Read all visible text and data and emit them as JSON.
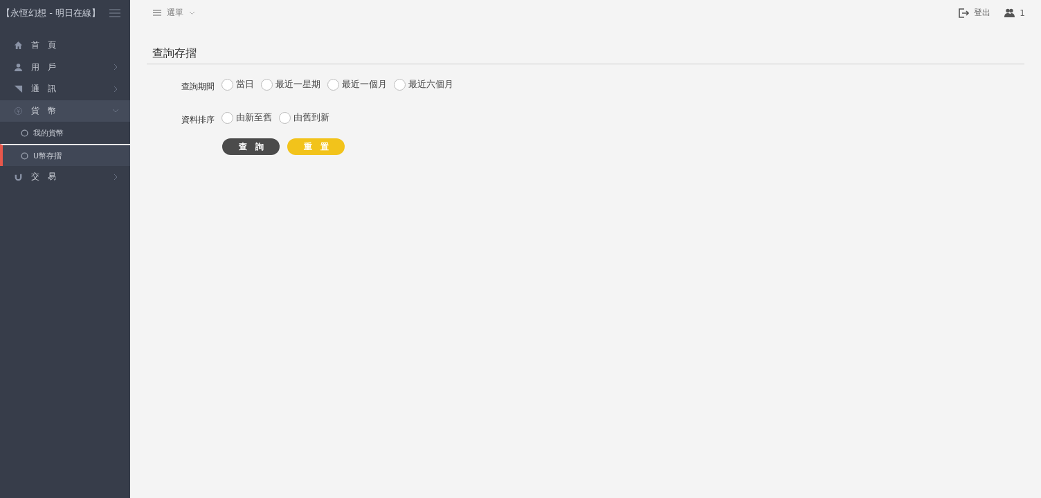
{
  "sidebar": {
    "title": "【永恆幻想 - 明日在線】",
    "items": [
      {
        "kind": "link",
        "label": "首　頁",
        "expanded": false,
        "selected": false
      },
      {
        "kind": "group",
        "label": "用　戶",
        "expanded": false,
        "selected": false
      },
      {
        "kind": "group",
        "label": "通　訊",
        "expanded": false,
        "selected": false
      },
      {
        "kind": "group",
        "label": "貨　幣",
        "expanded": true,
        "selected": false,
        "children": [
          {
            "label": "我的貨幣",
            "selected": false
          },
          {
            "label": "U幣存摺",
            "selected": true
          }
        ]
      },
      {
        "kind": "group",
        "label": "交　易",
        "expanded": false,
        "selected": false
      }
    ]
  },
  "topbar": {
    "menu_label": "選單",
    "logout": "登出",
    "online_count": "1"
  },
  "page": {
    "title": "查詢存摺",
    "fields": [
      {
        "label": "查詢期間",
        "options": [
          {
            "label": "當日",
            "selected": false
          },
          {
            "label": "最近一星期",
            "selected": false
          },
          {
            "label": "最近一個月",
            "selected": false
          },
          {
            "label": "最近六個月",
            "selected": false
          }
        ]
      },
      {
        "label": "資料排序",
        "options": [
          {
            "label": "由新至舊",
            "selected": false
          },
          {
            "label": "由舊到新",
            "selected": false
          }
        ]
      }
    ],
    "buttons": [
      {
        "kind": "primary",
        "label": "查　詢"
      },
      {
        "kind": "reset",
        "label": "重　置"
      }
    ]
  }
}
